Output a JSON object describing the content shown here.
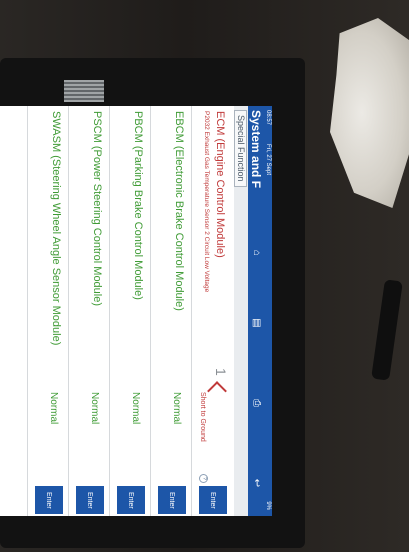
{
  "statusbar": {
    "time": "08:57",
    "date": "Fri, 27 Sept",
    "battery": "9%"
  },
  "titlebar": {
    "title": "System and F"
  },
  "subbar": {
    "special_function_label": "Special Function"
  },
  "rows": [
    {
      "module": "ECM (Engine Control Module)",
      "dtc": "P2032 Exhaust Gas Temperature Sensor 2 Circuit Low Voltage",
      "fault_count": "1",
      "status": "Short to Ground",
      "enter": "Enter"
    },
    {
      "module": "EBCM (Electronic Brake Control Module)",
      "status": "Normal",
      "enter": "Enter"
    },
    {
      "module": "PBCM (Parking Brake Control Module)",
      "status": "Normal",
      "enter": "Enter"
    },
    {
      "module": "PSCM (Power Steering Control Module)",
      "status": "Normal",
      "enter": "Enter"
    },
    {
      "module": "SWASM (Steering Wheel Angle Sensor Module)",
      "status": "Normal",
      "enter": "Enter"
    }
  ],
  "colors": {
    "accent": "#1d56a8",
    "normal": "#3f9b35",
    "fault": "#c03a3a"
  }
}
